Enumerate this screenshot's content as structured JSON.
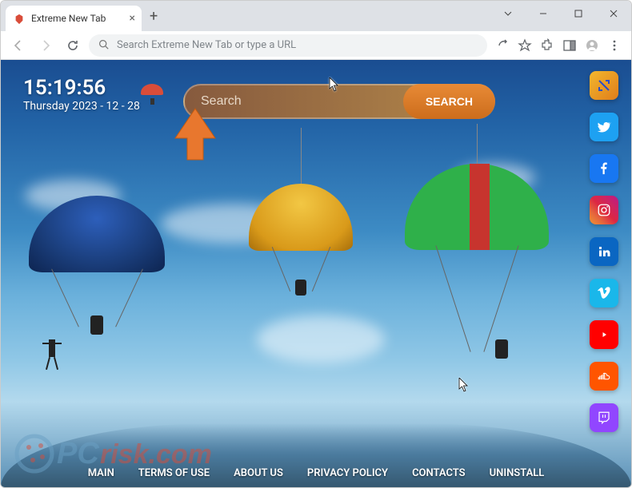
{
  "window": {
    "tab_title": "Extreme New Tab"
  },
  "address_bar": {
    "placeholder": "Search Extreme New Tab or type a URL"
  },
  "clock": {
    "time": "15:19:56",
    "date": "Thursday 2023 - 12 - 28"
  },
  "search": {
    "placeholder": "Search",
    "button_label": "SEARCH"
  },
  "social": {
    "items": [
      {
        "name": "custom",
        "title": "Extreme"
      },
      {
        "name": "twitter",
        "title": "Twitter"
      },
      {
        "name": "facebook",
        "title": "Facebook"
      },
      {
        "name": "instagram",
        "title": "Instagram"
      },
      {
        "name": "linkedin",
        "title": "LinkedIn"
      },
      {
        "name": "vimeo",
        "title": "Vimeo"
      },
      {
        "name": "youtube",
        "title": "YouTube"
      },
      {
        "name": "soundcloud",
        "title": "SoundCloud"
      },
      {
        "name": "twitch",
        "title": "Twitch"
      }
    ]
  },
  "footer": {
    "links": [
      "MAIN",
      "TERMS OF USE",
      "ABOUT US",
      "PRIVACY POLICY",
      "CONTACTS",
      "UNINSTALL"
    ]
  },
  "watermark": {
    "text": "PCrisk.com"
  }
}
